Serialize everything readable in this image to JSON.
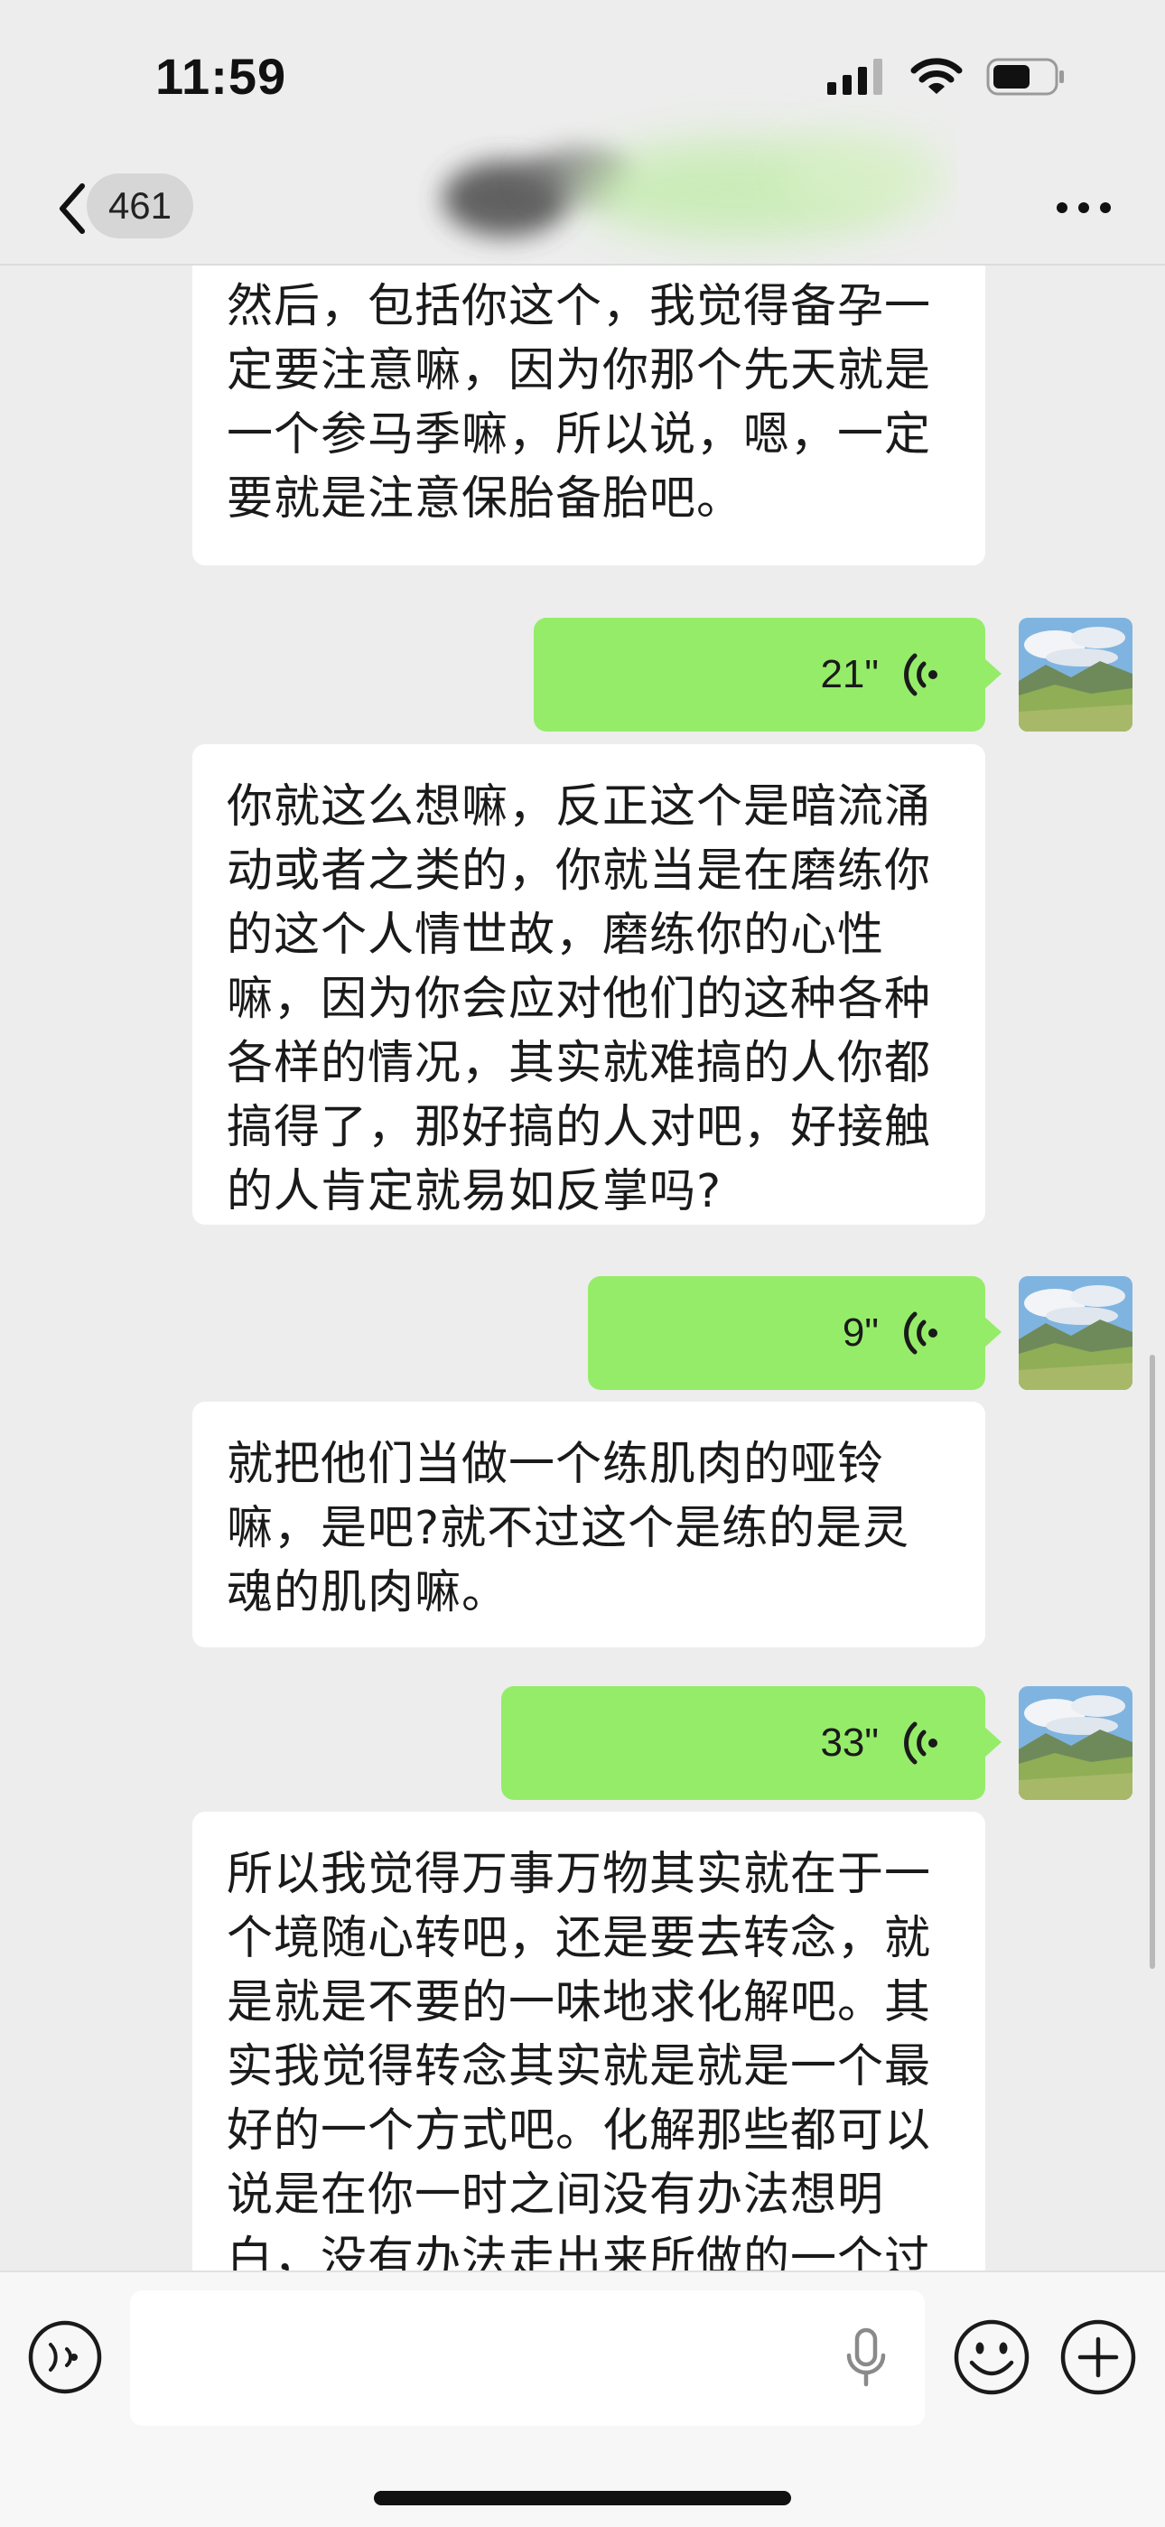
{
  "status_bar": {
    "time": "11:59"
  },
  "nav": {
    "unread_count": "461",
    "back_icon": "chevron-left-icon",
    "more_icon": "ellipsis-icon"
  },
  "messages": [
    {
      "side": "incoming",
      "type": "text",
      "text": "然后，包括你这个，我觉得备孕一\n定要注意嘛，因为你那个先天就是\n一个参马季嘛，所以说，嗯，一定\n要就是注意保胎备胎吧。"
    },
    {
      "side": "outgoing",
      "type": "voice",
      "duration": "21\""
    },
    {
      "side": "incoming",
      "type": "text",
      "text": "你就这么想嘛，反正这个是暗流涌\n动或者之类的，你就当是在磨练你\n的这个人情世故，磨练你的心性\n嘛，因为你会应对他们的这种各种\n各样的情况，其实就难搞的人你都\n搞得了，那好搞的人对吧，好接触\n的人肯定就易如反掌吗?"
    },
    {
      "side": "outgoing",
      "type": "voice",
      "duration": "9\""
    },
    {
      "side": "incoming",
      "type": "text",
      "text": "就把他们当做一个练肌肉的哑铃\n嘛，是吧?就不过这个是练的是灵\n魂的肌肉嘛。"
    },
    {
      "side": "outgoing",
      "type": "voice",
      "duration": "33\""
    },
    {
      "side": "incoming",
      "type": "text",
      "text": "所以我觉得万事万物其实就在于一\n个境随心转吧，还是要去转念，就\n是就是不要的一味地求化解吧。其\n实我觉得转念其实就是就是一个最\n好的一个方式吧。化解那些都可以\n说是在你一时之间没有办法想明\n白，没有办法走出来所做的一个过"
    }
  ],
  "input_bar": {
    "placeholder": "",
    "voice_icon": "voice-mode-icon",
    "mic_icon": "microphone-icon",
    "emoji_icon": "emoji-icon",
    "plus_icon": "plus-icon"
  },
  "colors": {
    "background": "#ededed",
    "outgoing_bubble": "#95ec69",
    "incoming_bubble": "#ffffff"
  }
}
